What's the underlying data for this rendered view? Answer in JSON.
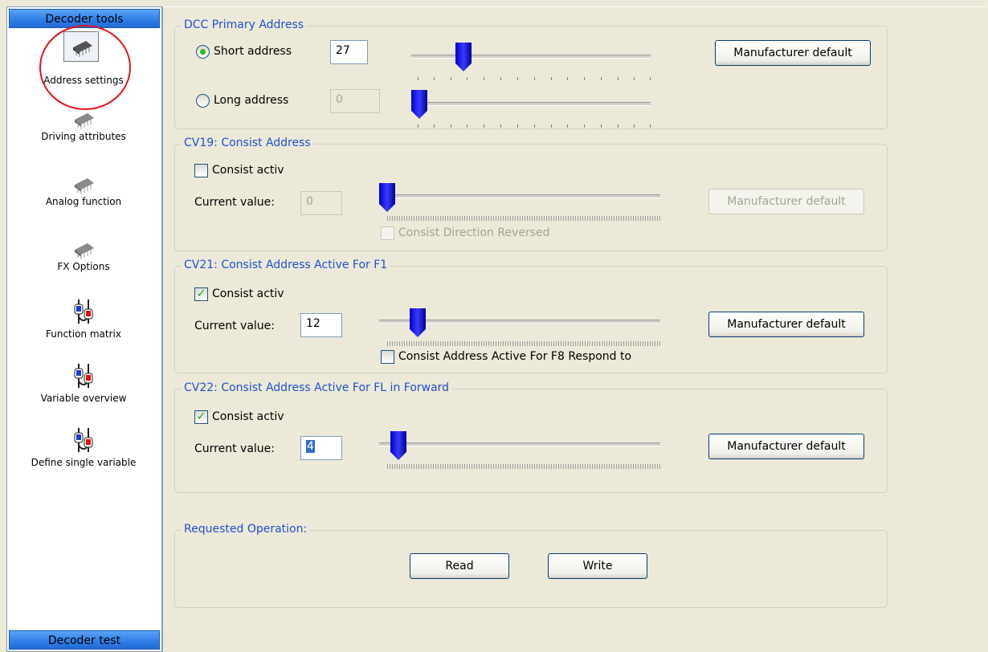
{
  "sidebar": {
    "header_top": "Decoder tools",
    "header_bottom": "Decoder test",
    "items": [
      {
        "label": "Address settings",
        "icon": "decoder-chip-icon"
      },
      {
        "label": "Driving attributes",
        "icon": "decoder-chip-icon"
      },
      {
        "label": "Analog function",
        "icon": "decoder-chip-icon"
      },
      {
        "label": "FX Options",
        "icon": "decoder-chip-icon"
      },
      {
        "label": "Function matrix",
        "icon": "matrix-ab-icon"
      },
      {
        "label": "Variable overview",
        "icon": "matrix-ab-icon"
      },
      {
        "label": "Define single variable",
        "icon": "matrix-ab-icon"
      }
    ],
    "selected_index": 0
  },
  "dcc": {
    "title": "DCC Primary Address",
    "short_label": "Short address",
    "short_value": "27",
    "short_selected": true,
    "long_label": "Long address",
    "long_value": "0",
    "manufacturer_default": "Manufacturer default"
  },
  "cv19": {
    "title": "CV19: Consist Address",
    "consist_label": "Consist activ",
    "consist_checked": false,
    "current_label": "Current value:",
    "current_value": "0",
    "manufacturer_default": "Manufacturer default",
    "direction_label": "Consist Direction Reversed"
  },
  "cv21": {
    "title": "CV21: Consist Address Active For F1",
    "consist_label": "Consist activ",
    "consist_checked": true,
    "current_label": "Current value:",
    "current_value": "12",
    "manufacturer_default": "Manufacturer default",
    "f8_label": "Consist Address Active For F8 Respond to"
  },
  "cv22": {
    "title": "CV22: Consist Address Active For FL in Forward",
    "consist_label": "Consist activ",
    "consist_checked": true,
    "current_label": "Current value:",
    "current_value": "4",
    "manufacturer_default": "Manufacturer default"
  },
  "operation": {
    "title": "Requested Operation:",
    "read": "Read",
    "write": "Write"
  },
  "colors": {
    "group_title": "#1f4fd1",
    "slider_thumb": "#1a1aff",
    "highlight_circle": "#e2141b",
    "sidebar_header": "#2f7de6"
  }
}
